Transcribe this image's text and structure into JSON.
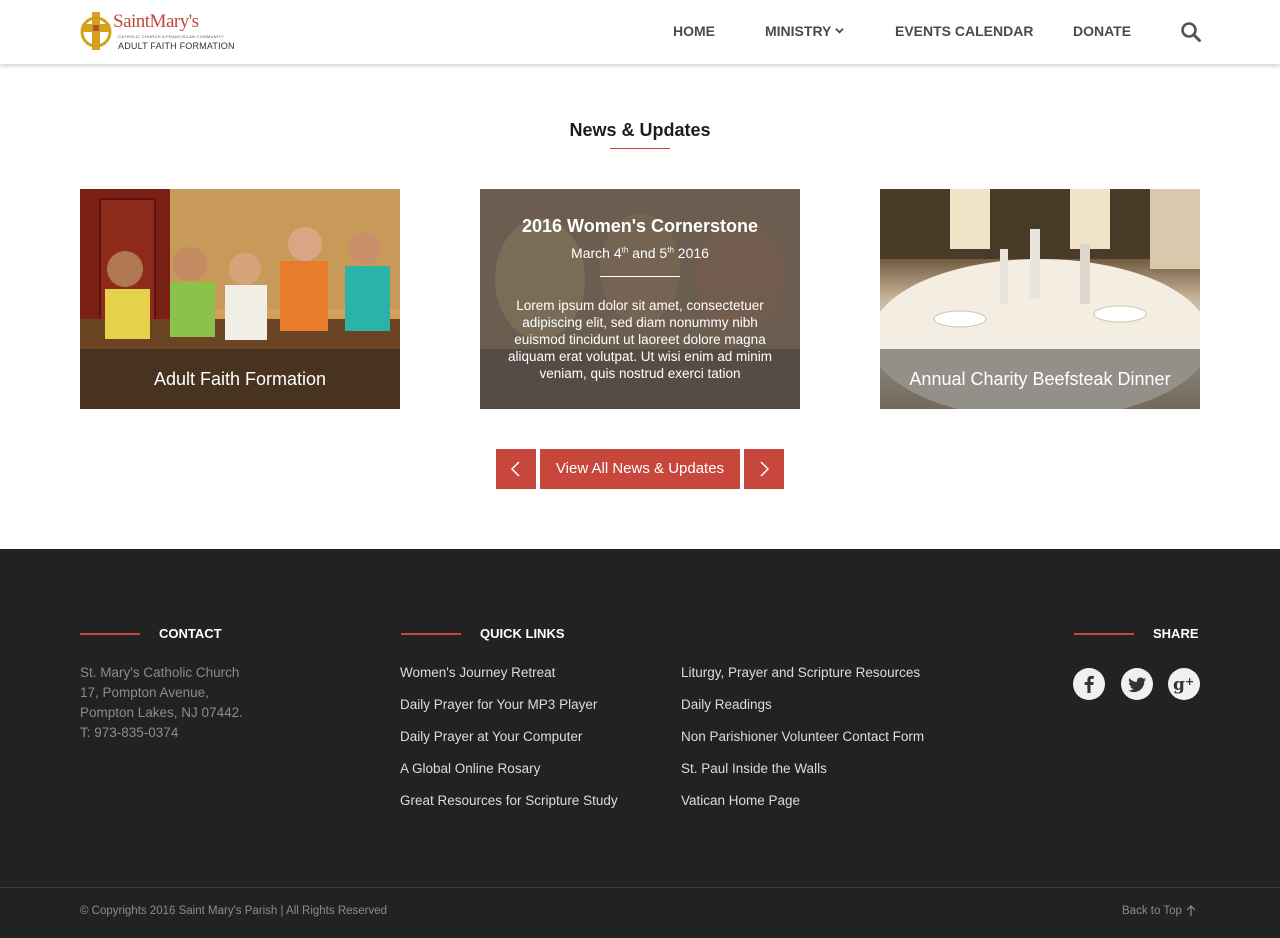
{
  "header": {
    "logo": {
      "name": "SaintMary's",
      "tagline": "CATHOLIC CHURCH  A FRANCISCAN COMMUNITY",
      "subtitle": "ADULT FAITH FORMATION"
    },
    "nav": [
      {
        "label": "HOME"
      },
      {
        "label": "MINISTRY",
        "icon": "chevron-down-icon"
      },
      {
        "label": "EVENTS CALENDAR"
      },
      {
        "label": "DONATE"
      }
    ],
    "search_icon": "search-icon"
  },
  "news": {
    "title": "News & Updates",
    "cards": [
      {
        "caption": "Adult Faith Formation"
      },
      {
        "title": "2016 Women's Cornerstone",
        "date_prefix": "March 4",
        "date_sup1": "th",
        "date_mid": " and 5",
        "date_sup2": "th",
        "date_suffix": " 2016",
        "text": "Lorem ipsum dolor sit amet, consectetuer adipiscing elit, sed diam nonummy nibh euismod tincidunt ut laoreet dolore magna aliquam erat volutpat. Ut wisi enim ad minim veniam, quis nostrud exerci tation"
      },
      {
        "caption": "Annual Charity Beefsteak Dinner"
      }
    ],
    "view_all": "View All  News & Updates",
    "accent": "#c7473d"
  },
  "footer": {
    "contact": {
      "heading": "CONTACT",
      "lines": [
        "St. Mary's Catholic Church",
        "17, Pompton Avenue,",
        "Pompton Lakes, NJ 07442.",
        "T: 973-835-0374"
      ]
    },
    "quick_links": {
      "heading": "QUICK LINKS",
      "col1": [
        "Women's Journey Retreat",
        "Daily Prayer for Your MP3 Player",
        "Daily Prayer at Your Computer",
        "A Global Online Rosary",
        "Great Resources for Scripture Study"
      ],
      "col2": [
        "Liturgy, Prayer and Scripture Resources",
        "Daily Readings",
        "Non Parishioner Volunteer Contact Form",
        "St. Paul Inside the Walls",
        "Vatican Home Page"
      ]
    },
    "share": {
      "heading": "SHARE",
      "icons": [
        "facebook-icon",
        "twitter-icon",
        "google-plus-icon"
      ]
    },
    "copyright": "© Copyrights  2016 Saint Mary's Parish   |   All Rights Reserved",
    "back_to_top": "Back to Top"
  }
}
